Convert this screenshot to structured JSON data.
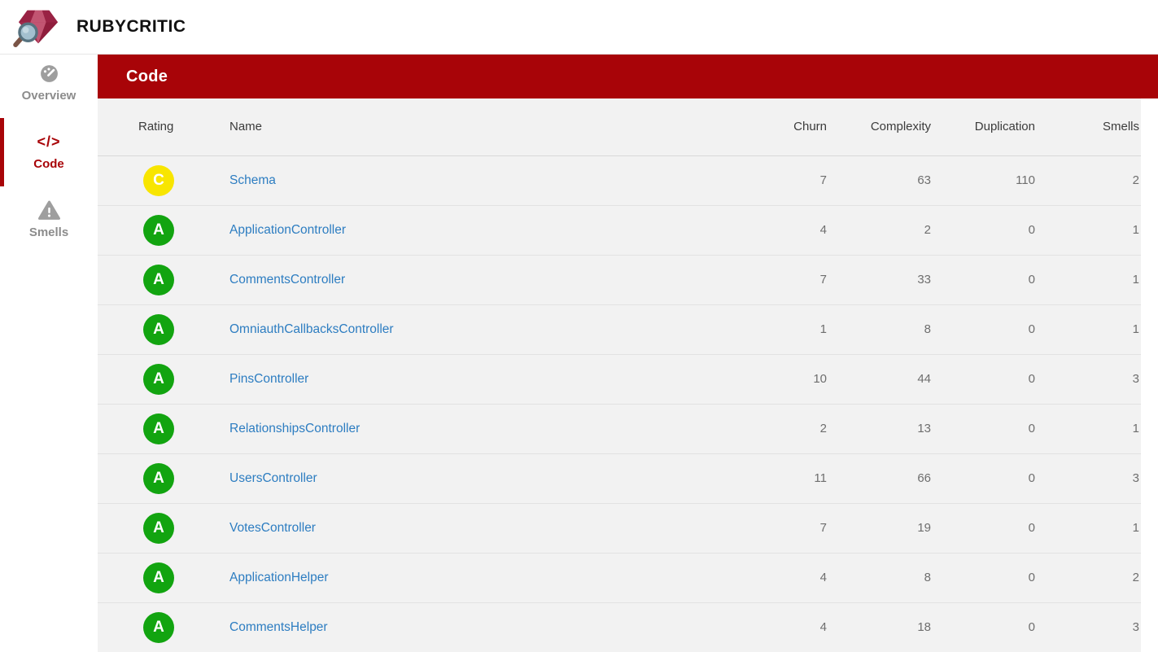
{
  "app": {
    "title": "RUBYCRITIC"
  },
  "sidebar": {
    "items": [
      {
        "id": "overview",
        "label": "Overview",
        "icon": "gauge-icon",
        "active": false
      },
      {
        "id": "code",
        "label": "Code",
        "icon": "code-icon",
        "active": true
      },
      {
        "id": "smells",
        "label": "Smells",
        "icon": "warning-icon",
        "active": false
      }
    ]
  },
  "page": {
    "title": "Code"
  },
  "table": {
    "columns": [
      "Rating",
      "Name",
      "Churn",
      "Complexity",
      "Duplication",
      "Smells"
    ],
    "rows": [
      {
        "rating": "C",
        "name": "Schema",
        "churn": 7,
        "complexity": 63,
        "duplication": 110,
        "smells": 2
      },
      {
        "rating": "A",
        "name": "ApplicationController",
        "churn": 4,
        "complexity": 2,
        "duplication": 0,
        "smells": 1
      },
      {
        "rating": "A",
        "name": "CommentsController",
        "churn": 7,
        "complexity": 33,
        "duplication": 0,
        "smells": 1
      },
      {
        "rating": "A",
        "name": "OmniauthCallbacksController",
        "churn": 1,
        "complexity": 8,
        "duplication": 0,
        "smells": 1
      },
      {
        "rating": "A",
        "name": "PinsController",
        "churn": 10,
        "complexity": 44,
        "duplication": 0,
        "smells": 3
      },
      {
        "rating": "A",
        "name": "RelationshipsController",
        "churn": 2,
        "complexity": 13,
        "duplication": 0,
        "smells": 1
      },
      {
        "rating": "A",
        "name": "UsersController",
        "churn": 11,
        "complexity": 66,
        "duplication": 0,
        "smells": 3
      },
      {
        "rating": "A",
        "name": "VotesController",
        "churn": 7,
        "complexity": 19,
        "duplication": 0,
        "smells": 1
      },
      {
        "rating": "A",
        "name": "ApplicationHelper",
        "churn": 4,
        "complexity": 8,
        "duplication": 0,
        "smells": 2
      },
      {
        "rating": "A",
        "name": "CommentsHelper",
        "churn": 4,
        "complexity": 18,
        "duplication": 0,
        "smells": 3
      }
    ]
  },
  "colors": {
    "accent_red": "#a80408",
    "link_blue": "#2d7dc1",
    "ratings": {
      "A": "#12a410",
      "B": "#9acd32",
      "C": "#f8e500",
      "D": "#ff8c00",
      "F": "#ff0000"
    }
  }
}
